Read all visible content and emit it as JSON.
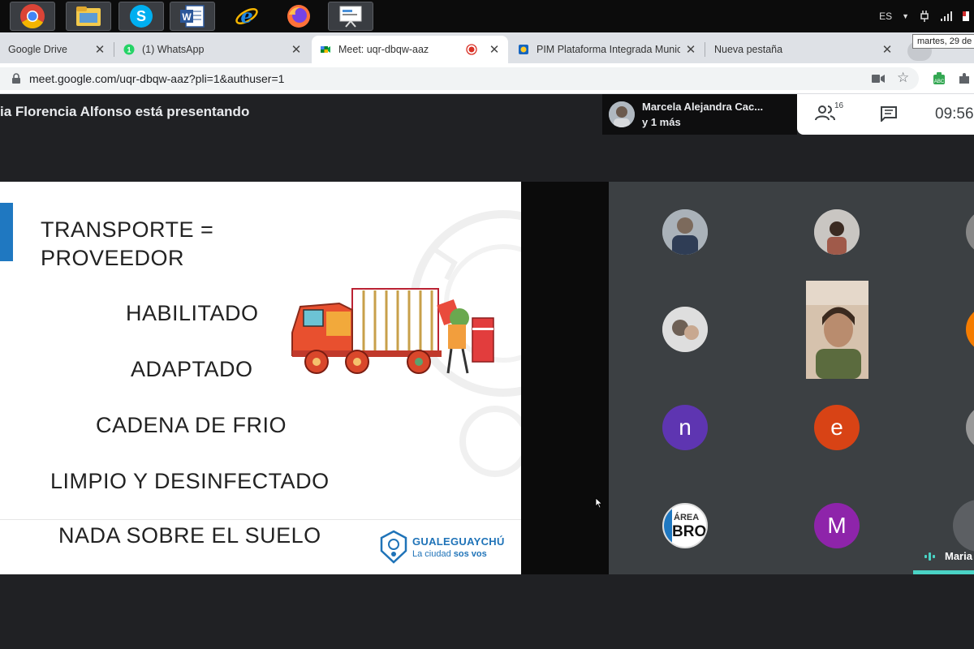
{
  "taskbar": {
    "apps": [
      "chrome",
      "file-explorer",
      "skype",
      "word",
      "internet-explorer",
      "firefox",
      "presentation"
    ],
    "language": "ES"
  },
  "tooltip": "martes, 29 de",
  "tabs": [
    {
      "title": "Google Drive",
      "icon": "drive-icon"
    },
    {
      "title": "(1) WhatsApp",
      "icon": "whatsapp-icon"
    },
    {
      "title": "Meet: uqr-dbqw-aaz",
      "icon": "meet-icon",
      "active": true,
      "recording": true
    },
    {
      "title": "PIM Plataforma Integrada Munic",
      "icon": "pim-icon"
    },
    {
      "title": "Nueva pestaña",
      "icon": ""
    }
  ],
  "address": {
    "url": "meet.google.com/uqr-dbqw-aaz?pli=1&authuser=1"
  },
  "meet": {
    "presenter_text": "ia Florencia Alfonso está presentando",
    "speaker": {
      "name": "Marcela Alejandra Cac...",
      "extra": "y 1 más"
    },
    "participants_count": "16",
    "clock": "09:56"
  },
  "slide": {
    "heading_line1": "TRANSPORTE =",
    "heading_line2": "PROVEEDOR",
    "items": [
      "HABILITADO",
      "ADAPTADO",
      "CADENA DE FRIO",
      "LIMPIO Y DESINFECTADO",
      "NADA SOBRE EL SUELO"
    ],
    "logo_name": "GUALEGUAYCHÚ",
    "logo_tagline_part1": "La ciudad ",
    "logo_tagline_part2": "sos vos"
  },
  "participants": {
    "initials": [
      "n",
      "e",
      "M"
    ],
    "badge_line1": "ÁREA",
    "badge_line2": "BRO",
    "active_label": "Maria",
    "colors": {
      "n": "#5e35b1",
      "e": "#d84315",
      "M": "#8e24aa",
      "accent": "#4ad3c5"
    }
  }
}
